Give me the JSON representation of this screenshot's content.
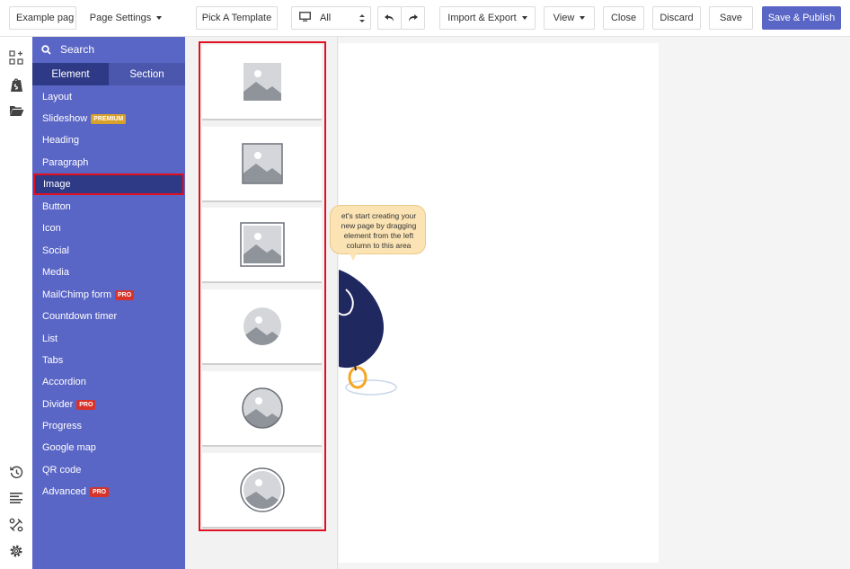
{
  "toolbar": {
    "page_name": "Example pag",
    "page_settings": "Page Settings",
    "pick_template": "Pick A Template",
    "device_value": "All",
    "import_export": "Import & Export",
    "view": "View",
    "close": "Close",
    "discard": "Discard",
    "save": "Save",
    "save_publish": "Save & Publish"
  },
  "rail": {
    "icons": [
      "add-element-icon",
      "shopify-bag-icon",
      "folder-icon",
      "history-icon",
      "outline-list-icon",
      "tools-icon",
      "settings-gear-icon"
    ]
  },
  "sidebar": {
    "search_label": "Search",
    "tabs": [
      "Element",
      "Section"
    ],
    "items": [
      {
        "label": "Layout",
        "badge": ""
      },
      {
        "label": "Slideshow",
        "badge": "PREMIUM"
      },
      {
        "label": "Heading",
        "badge": ""
      },
      {
        "label": "Paragraph",
        "badge": ""
      },
      {
        "label": "Image",
        "badge": ""
      },
      {
        "label": "Button",
        "badge": ""
      },
      {
        "label": "Icon",
        "badge": ""
      },
      {
        "label": "Social",
        "badge": ""
      },
      {
        "label": "Media",
        "badge": ""
      },
      {
        "label": "MailChimp form",
        "badge": "PRO"
      },
      {
        "label": "Countdown timer",
        "badge": ""
      },
      {
        "label": "List",
        "badge": ""
      },
      {
        "label": "Tabs",
        "badge": ""
      },
      {
        "label": "Accordion",
        "badge": ""
      },
      {
        "label": "Divider",
        "badge": "PRO"
      },
      {
        "label": "Progress",
        "badge": ""
      },
      {
        "label": "Google map",
        "badge": ""
      },
      {
        "label": "QR code",
        "badge": ""
      },
      {
        "label": "Advanced",
        "badge": "PRO"
      }
    ],
    "selected": "Image"
  },
  "thumbnails": [
    {
      "style": "square-plain"
    },
    {
      "style": "square-border"
    },
    {
      "style": "square-double-border"
    },
    {
      "style": "circle-plain"
    },
    {
      "style": "circle-border"
    },
    {
      "style": "circle-double-border"
    }
  ],
  "canvas": {
    "bubble_lines": [
      "et's start creating your",
      "new page by dragging",
      "element from the left",
      "column to this area"
    ]
  },
  "colors": {
    "sidebar": "#5a66c6",
    "active_tab": "#2e3a86",
    "publish": "#5a66c6",
    "highlight": "#e01020",
    "premium_badge": "#d7a12a",
    "pro_badge": "#d7332a"
  }
}
